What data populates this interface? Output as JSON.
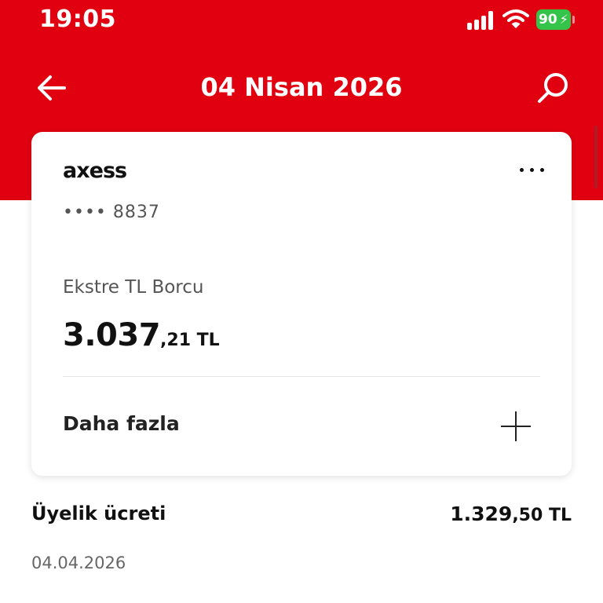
{
  "status_bar": {
    "time": "19:05",
    "battery_level": "90"
  },
  "header": {
    "title": "04 Nisan 2026",
    "icons": [
      "arrow-left-icon",
      "search-icon"
    ]
  },
  "card": {
    "brand": "axess",
    "masked_number": "•••• 8837",
    "debt_label": "Ekstre TL Borcu",
    "debt_amount_main": "3.037",
    "debt_amount_fraction": ",21 TL",
    "more_label": "Daha fazla"
  },
  "transaction": {
    "title": "Üyelik ücreti",
    "amount_main": "1.329",
    "amount_fraction": ",50 TL",
    "date": "04.04.2026"
  },
  "colors": {
    "brand_red": "#e10010",
    "battery_green": "#35c44a"
  }
}
